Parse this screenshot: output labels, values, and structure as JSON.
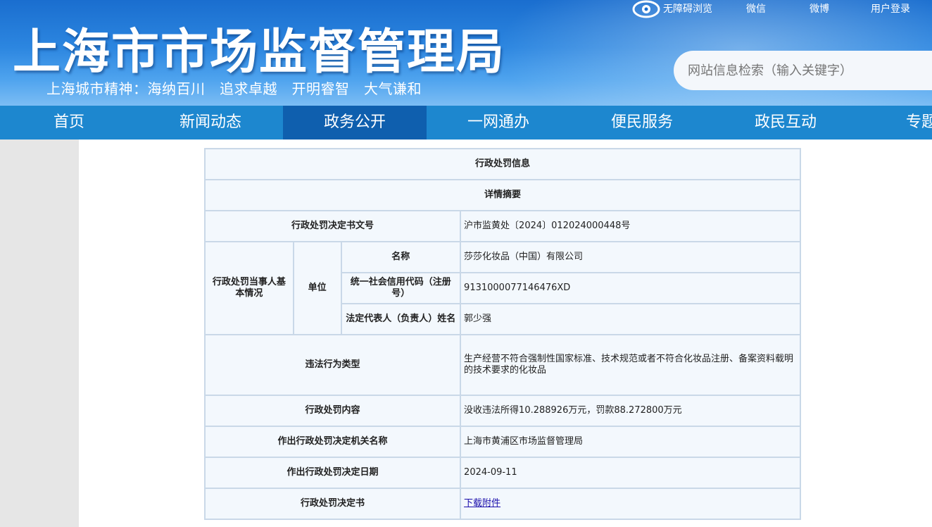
{
  "header": {
    "title": "上海市市场监督管理局",
    "motto": "上海城市精神：海纳百川　追求卓越　开明睿智　大气谦和",
    "toplinks": {
      "accessibility": "无障碍浏览",
      "weixin": "微信",
      "weibo": "微博",
      "login": "用户登录"
    },
    "search_placeholder": "网站信息检索（输入关键字）"
  },
  "nav": {
    "items": [
      "首页",
      "新闻动态",
      "政务公开",
      "一网通办",
      "便民服务",
      "政民互动",
      "专题专"
    ],
    "active": "政务公开"
  },
  "table": {
    "title": "行政处罚信息",
    "subtitle": "详情摘要",
    "rows": {
      "doc_no_label": "行政处罚决定书文号",
      "doc_no_value": "沪市监黄处〔2024〕012024000448号",
      "party_label": "行政处罚当事人基本情况",
      "unit_label": "单位",
      "name_label": "名称",
      "name_value": "莎莎化妆品（中国）有限公司",
      "credit_label": "统一社会信用代码（注册号）",
      "credit_value": "9131000077146476XD",
      "rep_label": "法定代表人（负责人）姓名",
      "rep_value": "郭少强",
      "violation_label": "违法行为类型",
      "violation_value": "生产经营不符合强制性国家标准、技术规范或者不符合化妆品注册、备案资料载明的技术要求的化妆品",
      "content_label": "行政处罚内容",
      "content_value": "没收违法所得10.288926万元，罚款88.272800万元",
      "authority_label": "作出行政处罚决定机关名称",
      "authority_value": "上海市黄浦区市场监督管理局",
      "date_label": "作出行政处罚决定日期",
      "date_value": "2024-09-11",
      "decision_label": "行政处罚决定书",
      "decision_link": "下载附件"
    }
  },
  "colors": {
    "header_top": "#1a6ecf",
    "nav": "#1d87cf",
    "nav_active": "#0f5fae",
    "table_bg": "#f3f8fd",
    "table_border": "#c9d8e8"
  }
}
